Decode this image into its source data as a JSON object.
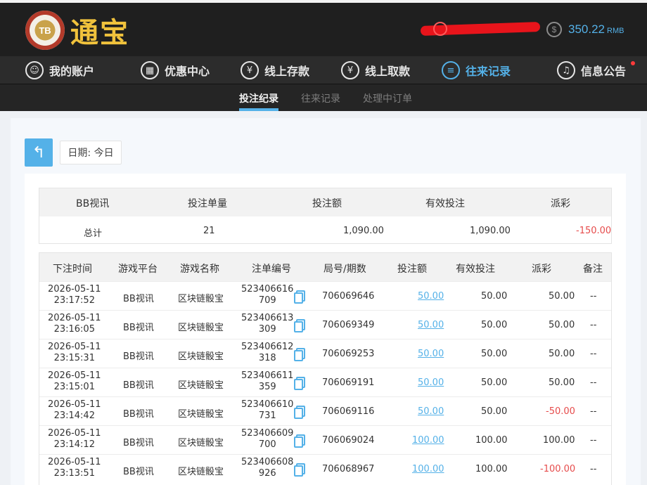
{
  "brand": {
    "badge": "TB",
    "name": "通宝"
  },
  "account": {
    "balance": "350.22",
    "currency": "RMB",
    "coin_symbol": "$"
  },
  "nav": [
    {
      "label": "我的账户",
      "icon": "user-icon"
    },
    {
      "label": "优惠中心",
      "icon": "gift-icon"
    },
    {
      "label": "线上存款",
      "icon": "deposit-icon"
    },
    {
      "label": "线上取款",
      "icon": "withdraw-icon"
    },
    {
      "label": "往来记录",
      "icon": "records-icon"
    },
    {
      "label": "信息公告",
      "icon": "bell-icon"
    }
  ],
  "subnav": [
    "投注纪录",
    "往来记录",
    "处理中订单"
  ],
  "filter": {
    "date_label": "日期: 今日"
  },
  "summary": {
    "headers": [
      "BB视讯",
      "投注单量",
      "投注额",
      "有效投注",
      "派彩"
    ],
    "values": [
      "总计",
      "21",
      "1,090.00",
      "1,090.00",
      "-150.00"
    ]
  },
  "table": {
    "headers": [
      "下注时间",
      "游戏平台",
      "游戏名称",
      "注单编号",
      "局号/期数",
      "投注额",
      "有效投注",
      "派彩",
      "备注"
    ],
    "rows": [
      {
        "date": "2026-05-11",
        "time": "23:17:52",
        "platform": "BB视讯",
        "game": "区块链骰宝",
        "id1": "523406616",
        "id2": "709",
        "round": "706069646",
        "bet": "50.00",
        "valid": "50.00",
        "payout": "50.00",
        "note": "--"
      },
      {
        "date": "2026-05-11",
        "time": "23:16:05",
        "platform": "BB视讯",
        "game": "区块链骰宝",
        "id1": "523406613",
        "id2": "309",
        "round": "706069349",
        "bet": "50.00",
        "valid": "50.00",
        "payout": "50.00",
        "note": "--"
      },
      {
        "date": "2026-05-11",
        "time": "23:15:31",
        "platform": "BB视讯",
        "game": "区块链骰宝",
        "id1": "523406612",
        "id2": "318",
        "round": "706069253",
        "bet": "50.00",
        "valid": "50.00",
        "payout": "50.00",
        "note": "--"
      },
      {
        "date": "2026-05-11",
        "time": "23:15:01",
        "platform": "BB视讯",
        "game": "区块链骰宝",
        "id1": "523406611",
        "id2": "359",
        "round": "706069191",
        "bet": "50.00",
        "valid": "50.00",
        "payout": "50.00",
        "note": "--"
      },
      {
        "date": "2026-05-11",
        "time": "23:14:42",
        "platform": "BB视讯",
        "game": "区块链骰宝",
        "id1": "523406610",
        "id2": "731",
        "round": "706069116",
        "bet": "50.00",
        "valid": "50.00",
        "payout": "-50.00",
        "note": "--"
      },
      {
        "date": "2026-05-11",
        "time": "23:14:12",
        "platform": "BB视讯",
        "game": "区块链骰宝",
        "id1": "523406609",
        "id2": "700",
        "round": "706069024",
        "bet": "100.00",
        "valid": "100.00",
        "payout": "100.00",
        "note": "--"
      },
      {
        "date": "2026-05-11",
        "time": "23:13:51",
        "platform": "BB视讯",
        "game": "区块链骰宝",
        "id1": "523406608",
        "id2": "926",
        "round": "706068967",
        "bet": "100.00",
        "valid": "100.00",
        "payout": "-100.00",
        "note": "--"
      }
    ]
  },
  "colors": {
    "accent": "#54b1e8",
    "negative": "#e64b4b",
    "logo_gold": "#f0c23c"
  }
}
